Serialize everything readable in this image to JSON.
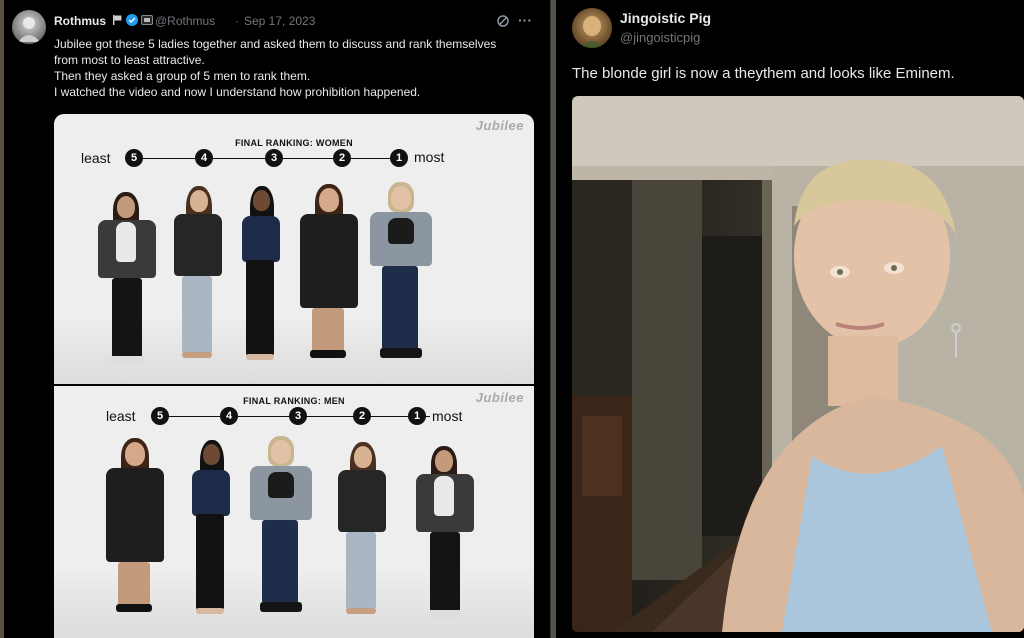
{
  "left_tweet": {
    "author": "Rothmus",
    "handle": "@Rothmus",
    "date": "Sep 17, 2023",
    "text_lines": [
      "Jubilee got these 5 ladies together and asked them to discuss and rank themselves",
      "from most to least attractive.",
      "Then they asked a group of 5 men to rank them.",
      "I watched the video and now I understand how prohibition happened."
    ],
    "more_icon": "ellipsis-icon",
    "grok_icon": "grok-icon"
  },
  "cards": {
    "women": {
      "title": "FINAL RANKING: WOMEN",
      "watermark": "Jubilee",
      "least": "least",
      "most": "most",
      "ranks": [
        "5",
        "4",
        "3",
        "2",
        "1"
      ]
    },
    "men": {
      "title": "FINAL RANKING: MEN",
      "watermark": "Jubilee",
      "least": "least",
      "most": "most",
      "ranks": [
        "5",
        "4",
        "3",
        "2",
        "1"
      ]
    }
  },
  "right_tweet": {
    "author": "Jingoistic Pig",
    "handle": "@jingoisticpig",
    "text": "The blonde girl is now a theythem and looks like Eminem."
  }
}
